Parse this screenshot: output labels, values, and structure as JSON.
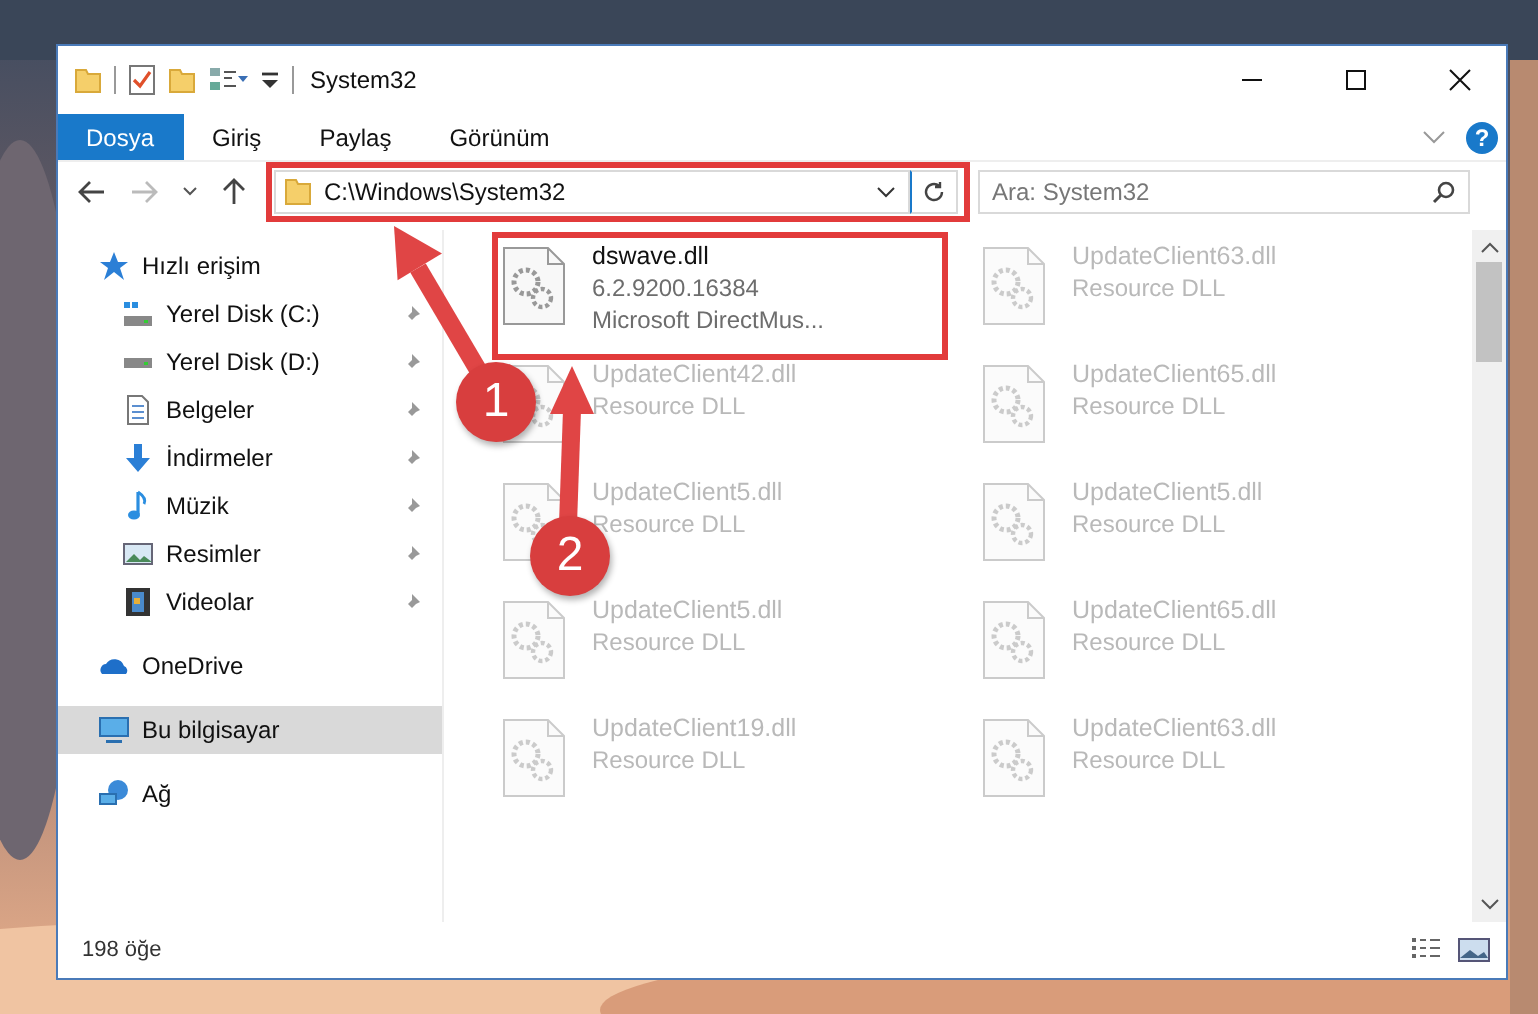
{
  "window": {
    "title": "System32"
  },
  "ribbon": {
    "tabs": [
      {
        "label": "Dosya",
        "selected": true
      },
      {
        "label": "Giriş",
        "selected": false
      },
      {
        "label": "Paylaş",
        "selected": false
      },
      {
        "label": "Görünüm",
        "selected": false
      }
    ],
    "help": "?"
  },
  "address_bar": {
    "path": "C:\\Windows\\System32"
  },
  "search": {
    "placeholder": "Ara: System32"
  },
  "sidebar": {
    "items": [
      {
        "label": "Hızlı erişim",
        "selected": false,
        "children": [
          {
            "label": "Yerel Disk (C:)",
            "pinned": true
          },
          {
            "label": "Yerel Disk (D:)",
            "pinned": true
          },
          {
            "label": "Belgeler",
            "pinned": true
          },
          {
            "label": "İndirmeler",
            "pinned": true
          },
          {
            "label": "Müzik",
            "pinned": true
          },
          {
            "label": "Resimler",
            "pinned": true
          },
          {
            "label": "Videolar",
            "pinned": true
          }
        ]
      },
      {
        "label": "OneDrive",
        "selected": false
      },
      {
        "label": "Bu bilgisayar",
        "selected": true
      },
      {
        "label": "Ağ",
        "selected": false
      }
    ]
  },
  "files": [
    {
      "name": "dswave.dll",
      "details": [
        "6.2.9200.16384",
        "Microsoft DirectMus..."
      ],
      "dimmed": false
    },
    {
      "name": "UpdateClient63.dll",
      "details": [
        "Resource DLL"
      ],
      "dimmed": true
    },
    {
      "name": "UpdateClient42.dll",
      "details": [
        "Resource DLL"
      ],
      "dimmed": true
    },
    {
      "name": "UpdateClient65.dll",
      "details": [
        "Resource DLL"
      ],
      "dimmed": true
    },
    {
      "name": "UpdateClient5.dll",
      "details": [
        "Resource DLL"
      ],
      "dimmed": true
    },
    {
      "name": "UpdateClient5.dll",
      "details": [
        "Resource DLL"
      ],
      "dimmed": true
    },
    {
      "name": "UpdateClient5.dll",
      "details": [
        "Resource DLL"
      ],
      "dimmed": true
    },
    {
      "name": "UpdateClient65.dll",
      "details": [
        "Resource DLL"
      ],
      "dimmed": true
    },
    {
      "name": "UpdateClient19.dll",
      "details": [
        "Resource DLL"
      ],
      "dimmed": true
    },
    {
      "name": "UpdateClient63.dll",
      "details": [
        "Resource DLL"
      ],
      "dimmed": true
    }
  ],
  "status_bar": {
    "item_count": "198 öğe"
  },
  "annotations": [
    {
      "label": "1"
    },
    {
      "label": "2"
    }
  ]
}
